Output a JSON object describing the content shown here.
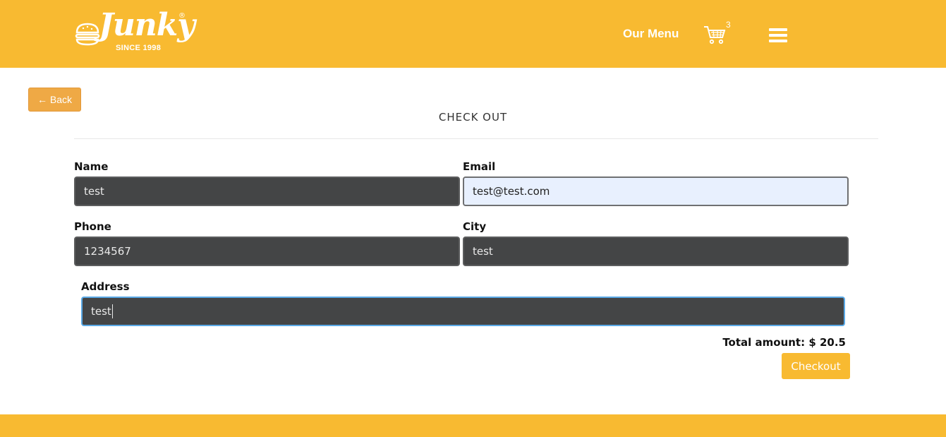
{
  "header": {
    "logo_text": "Junky",
    "logo_registered": "®",
    "logo_tagline": "SINCE 1998",
    "nav_menu_label": "Our Menu",
    "cart_count": "3",
    "colors": {
      "brand": "#F8BA31",
      "white": "#FFFFFF"
    },
    "icons": {
      "cart": "shopping-cart-icon",
      "menu": "hamburger-menu-icon",
      "logo": "burger-logo-icon"
    }
  },
  "page": {
    "back_label": "← Back",
    "title": "CHECK OUT"
  },
  "form": {
    "name_label": "Name",
    "name_value": "test",
    "email_label": "Email",
    "email_value": "test@test.com",
    "phone_label": "Phone",
    "phone_value": "1234567",
    "city_label": "City",
    "city_value": "test",
    "address_label": "Address",
    "address_value": "test"
  },
  "summary": {
    "total_text": "Total amount: $ 20.5",
    "checkout_label": "Checkout"
  }
}
